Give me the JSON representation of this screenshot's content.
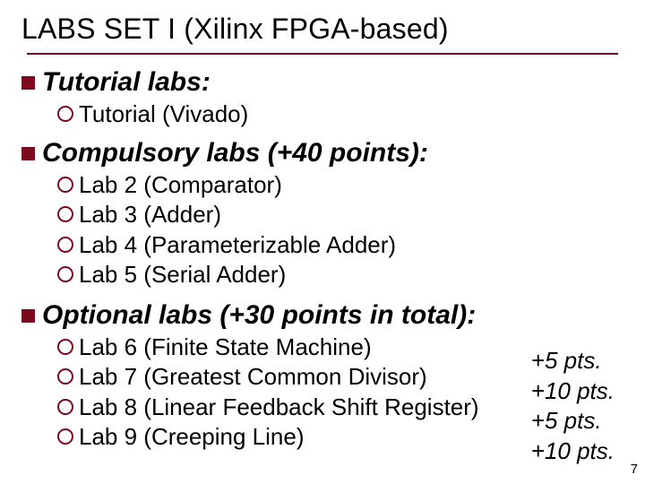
{
  "title": "LABS SET I (Xilinx FPGA-based)",
  "sections": {
    "tutorial": {
      "heading": "Tutorial labs:",
      "items": [
        "Tutorial (Vivado)"
      ]
    },
    "compulsory": {
      "heading": "Compulsory labs (+40 points):",
      "items": [
        "Lab 2 (Comparator)",
        "Lab 3 (Adder)",
        "Lab 4 (Parameterizable Adder)",
        "Lab 5 (Serial Adder)"
      ]
    },
    "optional": {
      "heading": "Optional labs (+30 points in total):",
      "items": [
        "Lab 6 (Finite State Machine)",
        "Lab 7 (Greatest Common Divisor)",
        "Lab 8 (Linear Feedback Shift Register)",
        "Lab 9 (Creeping Line)"
      ],
      "points": [
        "+5 pts.",
        "+10 pts.",
        "+5 pts.",
        "+10 pts."
      ]
    }
  },
  "page_number": "7"
}
